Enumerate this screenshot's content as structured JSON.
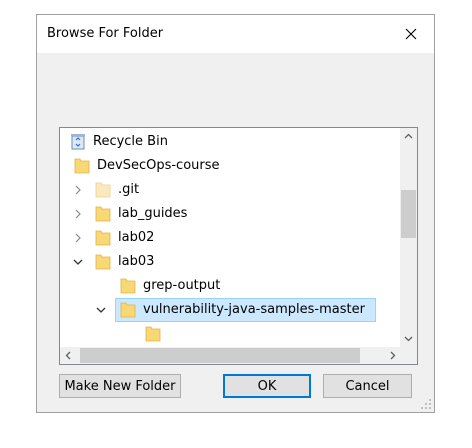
{
  "dialog": {
    "title": "Browse For Folder",
    "close_icon": "close-icon"
  },
  "tree": {
    "items": [
      {
        "label": "Recycle Bin",
        "icon": "recycle-bin-icon",
        "expander": "none"
      },
      {
        "label": "DevSecOps-course",
        "icon": "folder-icon",
        "expander": "none"
      },
      {
        "label": ".git",
        "icon": "folder-hidden-icon",
        "expander": "collapsed"
      },
      {
        "label": "lab_guides",
        "icon": "folder-icon",
        "expander": "collapsed"
      },
      {
        "label": "lab02",
        "icon": "folder-icon",
        "expander": "collapsed"
      },
      {
        "label": "lab03",
        "icon": "folder-icon",
        "expander": "expanded"
      },
      {
        "label": "grep-output",
        "icon": "folder-icon",
        "expander": "none"
      },
      {
        "label": "vulnerability-java-samples-master",
        "icon": "folder-icon",
        "expander": "expanded",
        "selected": true
      }
    ]
  },
  "buttons": {
    "new_folder": "Make New Folder",
    "ok": "OK",
    "cancel": "Cancel"
  },
  "colors": {
    "selection": "#cce8ff",
    "folder": "#f8d775",
    "default_button_border": "#0078d7"
  }
}
